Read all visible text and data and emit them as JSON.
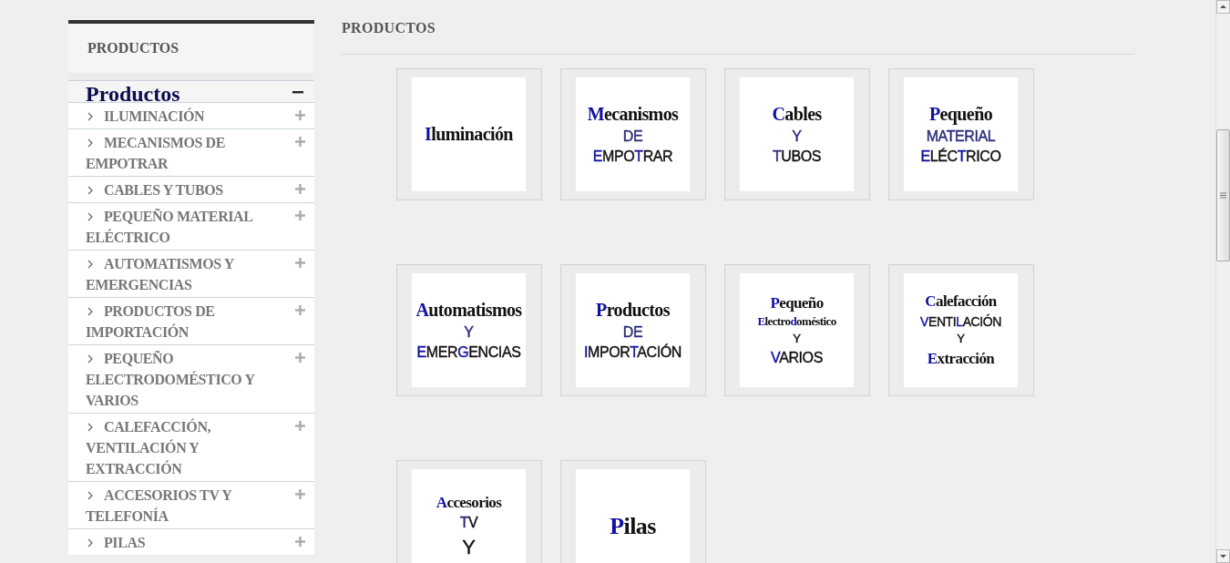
{
  "sidebar": {
    "title": "PRODUCTOS",
    "menu_header": {
      "label": "Productos",
      "expanded": true
    },
    "items": [
      {
        "label": "ILUMINACIÓN",
        "expanded": false
      },
      {
        "label": "MECANISMOS DE EMPOTRAR",
        "expanded": false
      },
      {
        "label": "CABLES Y TUBOS",
        "expanded": false
      },
      {
        "label": "PEQUEÑO MATERIAL ELÉCTRICO",
        "expanded": false
      },
      {
        "label": "AUTOMATISMOS Y EMERGENCIAS",
        "expanded": false
      },
      {
        "label": "PRODUCTOS DE IMPORTACIÓN",
        "expanded": false
      },
      {
        "label": "PEQUEÑO ELECTRODOMÉSTICO Y VARIOS",
        "expanded": false
      },
      {
        "label": "CALEFACCIÓN, VENTILACIÓN Y EXTRACCIÓN",
        "expanded": false
      },
      {
        "label": "ACCESORIOS TV Y TELEFONÍA",
        "expanded": false
      },
      {
        "label": "PILAS",
        "expanded": false
      }
    ]
  },
  "main": {
    "title": "PRODUCTOS",
    "tiles": [
      {
        "lines": [
          {
            "kind": "bold",
            "segments": [
              {
                "text": "I",
                "color": "#1010a0"
              },
              {
                "text": "luminación",
                "color": "#111111"
              }
            ]
          }
        ]
      },
      {
        "lines": [
          {
            "kind": "bold",
            "segments": [
              {
                "text": "M",
                "color": "#1010a0"
              },
              {
                "text": "ecanismos",
                "color": "#111111"
              }
            ]
          },
          {
            "kind": "light",
            "segments": [
              {
                "text": "DE",
                "color": "#2a2a7a"
              }
            ]
          },
          {
            "kind": "light",
            "segments": [
              {
                "text": "E",
                "color": "#1010a0"
              },
              {
                "text": "MPO",
                "color": "#111111"
              },
              {
                "text": "T",
                "color": "#1010a0"
              },
              {
                "text": "RAR",
                "color": "#111111"
              }
            ]
          }
        ]
      },
      {
        "lines": [
          {
            "kind": "bold",
            "segments": [
              {
                "text": "C",
                "color": "#1010a0"
              },
              {
                "text": "ables",
                "color": "#111111"
              }
            ]
          },
          {
            "kind": "light",
            "segments": [
              {
                "text": "Y",
                "color": "#2a2a7a"
              }
            ]
          },
          {
            "kind": "light",
            "segments": [
              {
                "text": "T",
                "color": "#2a2a7a"
              },
              {
                "text": "UBOS",
                "color": "#111111"
              }
            ]
          }
        ]
      },
      {
        "lines": [
          {
            "kind": "bold",
            "segments": [
              {
                "text": "P",
                "color": "#1010a0"
              },
              {
                "text": "equeño",
                "color": "#111111"
              }
            ]
          },
          {
            "kind": "light",
            "segments": [
              {
                "text": "MATERIAL",
                "color": "#2a2a7a"
              }
            ]
          },
          {
            "kind": "light",
            "segments": [
              {
                "text": "E",
                "color": "#1010a0"
              },
              {
                "text": "LÉC",
                "color": "#111111"
              },
              {
                "text": "T",
                "color": "#1010a0"
              },
              {
                "text": "RICO",
                "color": "#111111"
              }
            ]
          }
        ]
      },
      {
        "lines": [
          {
            "kind": "bold",
            "segments": [
              {
                "text": "A",
                "color": "#1010a0"
              },
              {
                "text": "utomatismos",
                "color": "#111111"
              }
            ]
          },
          {
            "kind": "light",
            "segments": [
              {
                "text": "Y",
                "color": "#2a2a7a"
              }
            ]
          },
          {
            "kind": "light",
            "segments": [
              {
                "text": "E",
                "color": "#1010a0"
              },
              {
                "text": "MER",
                "color": "#111111"
              },
              {
                "text": "G",
                "color": "#1010a0"
              },
              {
                "text": "ENCIAS",
                "color": "#111111"
              }
            ]
          }
        ]
      },
      {
        "lines": [
          {
            "kind": "bold",
            "segments": [
              {
                "text": "P",
                "color": "#1010a0"
              },
              {
                "text": "roductos",
                "color": "#111111"
              }
            ]
          },
          {
            "kind": "light",
            "segments": [
              {
                "text": "DE",
                "color": "#2a2a7a"
              }
            ]
          },
          {
            "kind": "light",
            "segments": [
              {
                "text": "I",
                "color": "#1010a0"
              },
              {
                "text": "MPOR",
                "color": "#111111"
              },
              {
                "text": "T",
                "color": "#1010a0"
              },
              {
                "text": "ACIÓN",
                "color": "#111111"
              }
            ]
          }
        ]
      },
      {
        "lines": [
          {
            "kind": "bold-small",
            "segments": [
              {
                "text": "P",
                "color": "#1010a0"
              },
              {
                "text": "equeño",
                "color": "#111111"
              }
            ]
          },
          {
            "kind": "bold-tiny",
            "segments": [
              {
                "text": "E",
                "color": "#1010a0"
              },
              {
                "text": "lectro",
                "color": "#111111"
              },
              {
                "text": "d",
                "color": "#1010a0"
              },
              {
                "text": "oméstico",
                "color": "#111111"
              }
            ]
          },
          {
            "kind": "light-tiny",
            "segments": [
              {
                "text": "Y",
                "color": "#111111"
              }
            ]
          },
          {
            "kind": "light",
            "segments": [
              {
                "text": "V",
                "color": "#1010a0"
              },
              {
                "text": "ARIOS",
                "color": "#111111"
              }
            ]
          }
        ]
      },
      {
        "lines": [
          {
            "kind": "bold-small",
            "segments": [
              {
                "text": "C",
                "color": "#1010a0"
              },
              {
                "text": "alefacción",
                "color": "#111111"
              }
            ]
          },
          {
            "kind": "light-small",
            "segments": [
              {
                "text": "V",
                "color": "#1010a0"
              },
              {
                "text": "ENTI",
                "color": "#111111"
              },
              {
                "text": "L",
                "color": "#1010a0"
              },
              {
                "text": "ACIÓN",
                "color": "#111111"
              }
            ]
          },
          {
            "kind": "light-tiny",
            "segments": [
              {
                "text": "Y",
                "color": "#111111"
              }
            ]
          },
          {
            "kind": "bold-small",
            "segments": [
              {
                "text": "E",
                "color": "#1010a0"
              },
              {
                "text": "xtracción",
                "color": "#111111"
              }
            ]
          }
        ]
      },
      {
        "lines": [
          {
            "kind": "bold-small",
            "segments": [
              {
                "text": "A",
                "color": "#1010a0"
              },
              {
                "text": "ccesorios",
                "color": "#111111"
              }
            ]
          },
          {
            "kind": "light",
            "segments": [
              {
                "text": "T",
                "color": "#2a2a7a"
              },
              {
                "text": "V",
                "color": "#111111"
              }
            ]
          },
          {
            "kind": "light-large",
            "segments": [
              {
                "text": "Y",
                "color": "#111111"
              }
            ]
          }
        ]
      },
      {
        "lines": [
          {
            "kind": "bold-large",
            "segments": [
              {
                "text": "P",
                "color": "#1010a0"
              },
              {
                "text": "ilas",
                "color": "#111111"
              }
            ]
          }
        ]
      }
    ]
  }
}
